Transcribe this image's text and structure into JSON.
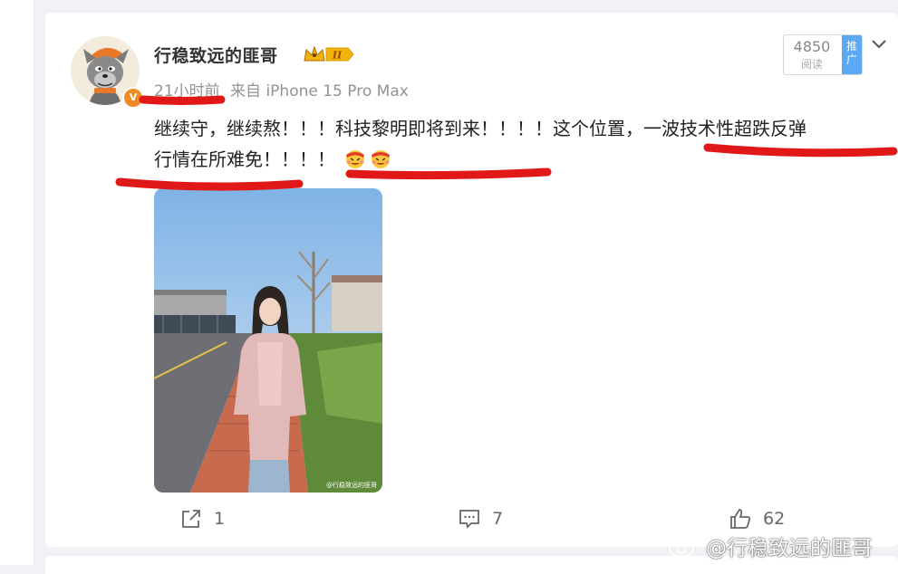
{
  "post": {
    "author": "行稳致远的匪哥",
    "level": "II",
    "time": "21小时前",
    "source": "来自 iPhone 15 Pro Max",
    "text_line1_part1": "继续守，继续熬！！！科技黎明即将到来！！！！这个位置，",
    "text_line1_part2": "一波技术性超跌反弹",
    "text_line2": "行情在所难免！！！！",
    "verified_mark": "V"
  },
  "stats": {
    "read_count": "4850",
    "read_label": "阅读",
    "promo_label_1": "推",
    "promo_label_2": "广"
  },
  "photo": {
    "watermark": "@行稳致远的匪哥"
  },
  "actions": {
    "share_count": "1",
    "comment_count": "7",
    "like_count": "62"
  },
  "watermark": {
    "text": "@行稳致远的匪哥"
  },
  "colors": {
    "annotation": "#e01818",
    "verified": "#f08a24",
    "promo": "#5ba8f5"
  },
  "icons": [
    "share-icon",
    "comment-icon",
    "like-icon",
    "chevron-down-icon",
    "weibo-icon"
  ]
}
